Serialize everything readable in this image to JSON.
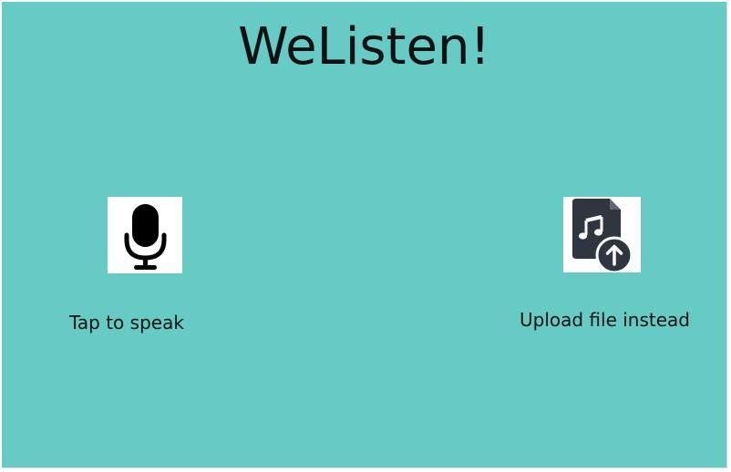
{
  "app": {
    "title": "WeListen!",
    "background_color": "#66cbc4"
  },
  "actions": {
    "speak": {
      "label": "Tap to speak",
      "icon": "microphone-icon"
    },
    "upload": {
      "label": "Upload file instead",
      "icon": "upload-audio-file-icon"
    }
  }
}
